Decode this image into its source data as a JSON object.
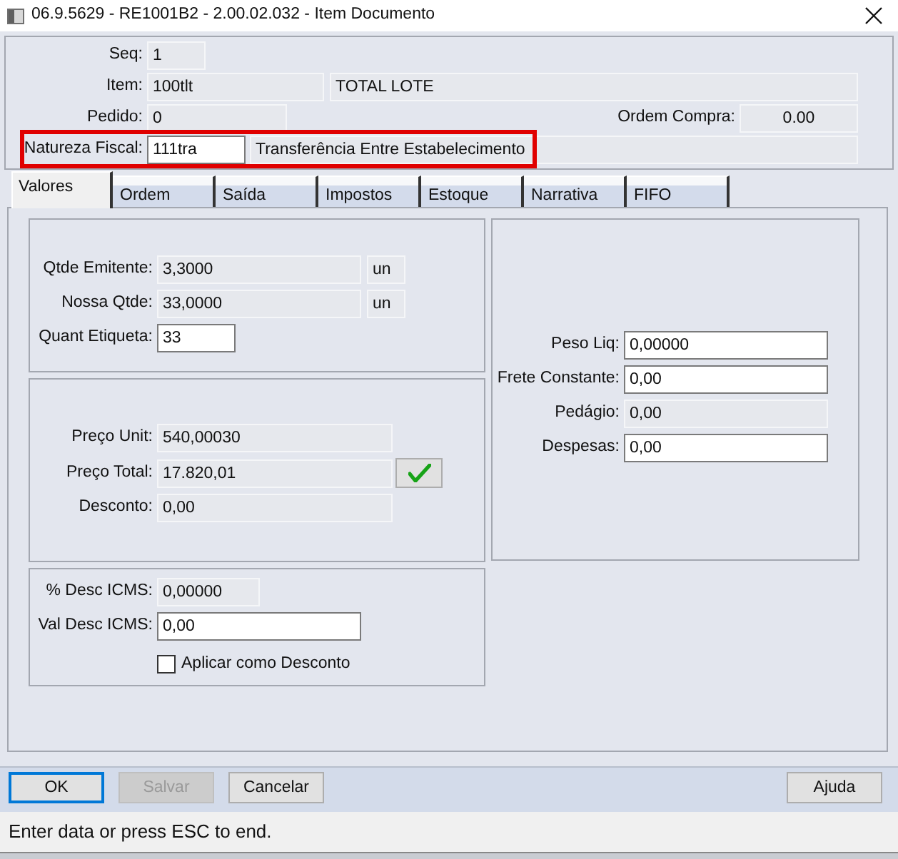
{
  "window": {
    "title": "06.9.5629 - RE1001B2 - 2.00.02.032 - Item Documento"
  },
  "header": {
    "seq": {
      "label": "Seq:",
      "value": "1"
    },
    "item": {
      "label": "Item:",
      "value": "100tlt",
      "description": "TOTAL LOTE"
    },
    "pedido": {
      "label": "Pedido:",
      "value": "0"
    },
    "ordem_compra": {
      "label": "Ordem Compra:",
      "value": "0.00"
    },
    "natureza_fiscal": {
      "label": "Natureza Fiscal:",
      "value": "111tra",
      "description": "Transferência Entre Estabelecimento",
      "highlighted": true
    }
  },
  "tabs": [
    {
      "label": "Valores",
      "selected": true
    },
    {
      "label": "Ordem",
      "selected": false
    },
    {
      "label": "Saída",
      "selected": false
    },
    {
      "label": "Impostos",
      "selected": false
    },
    {
      "label": "Estoque",
      "selected": false
    },
    {
      "label": "Narrativa",
      "selected": false
    },
    {
      "label": "FIFO",
      "selected": false
    }
  ],
  "valores": {
    "left_groups": [
      {
        "fields": [
          {
            "kind": "readonly",
            "label": "Qtde Emitente:",
            "value": "3,3000",
            "unit": "un"
          },
          {
            "kind": "readonly",
            "label": "Nossa Qtde:",
            "value": "33,0000",
            "unit": "un"
          },
          {
            "kind": "input",
            "label": "Quant Etiqueta:",
            "value": "33"
          }
        ]
      },
      {
        "fields": [
          {
            "kind": "readonly",
            "label": "Preço Unit:",
            "value": "540,00030"
          },
          {
            "kind": "readonly",
            "label": "Preço Total:",
            "value": "17.820,01",
            "confirm_button": true
          },
          {
            "kind": "readonly",
            "label": "Desconto:",
            "value": "0,00"
          }
        ]
      },
      {
        "fields": [
          {
            "kind": "readonly",
            "label": "% Desc ICMS:",
            "value": "0,00000"
          },
          {
            "kind": "input",
            "label": "Val Desc ICMS:",
            "value": "0,00"
          },
          {
            "kind": "checkbox",
            "label": "Aplicar como Desconto",
            "checked": false
          }
        ]
      }
    ],
    "right_group": {
      "fields": [
        {
          "kind": "input",
          "label": "Peso Liq:",
          "value": "0,00000"
        },
        {
          "kind": "input",
          "label": "Frete Constante:",
          "value": "0,00"
        },
        {
          "kind": "readonly",
          "label": "Pedágio:",
          "value": "0,00"
        },
        {
          "kind": "input",
          "label": "Despesas:",
          "value": "0,00"
        }
      ]
    }
  },
  "buttons": [
    {
      "label": "OK",
      "focused": true,
      "disabled": false
    },
    {
      "label": "Salvar",
      "focused": false,
      "disabled": true
    },
    {
      "label": "Cancelar",
      "focused": false,
      "disabled": false
    }
  ],
  "help_button": {
    "label": "Ajuda"
  },
  "status_bar": {
    "text": "Enter data or press ESC to end."
  }
}
